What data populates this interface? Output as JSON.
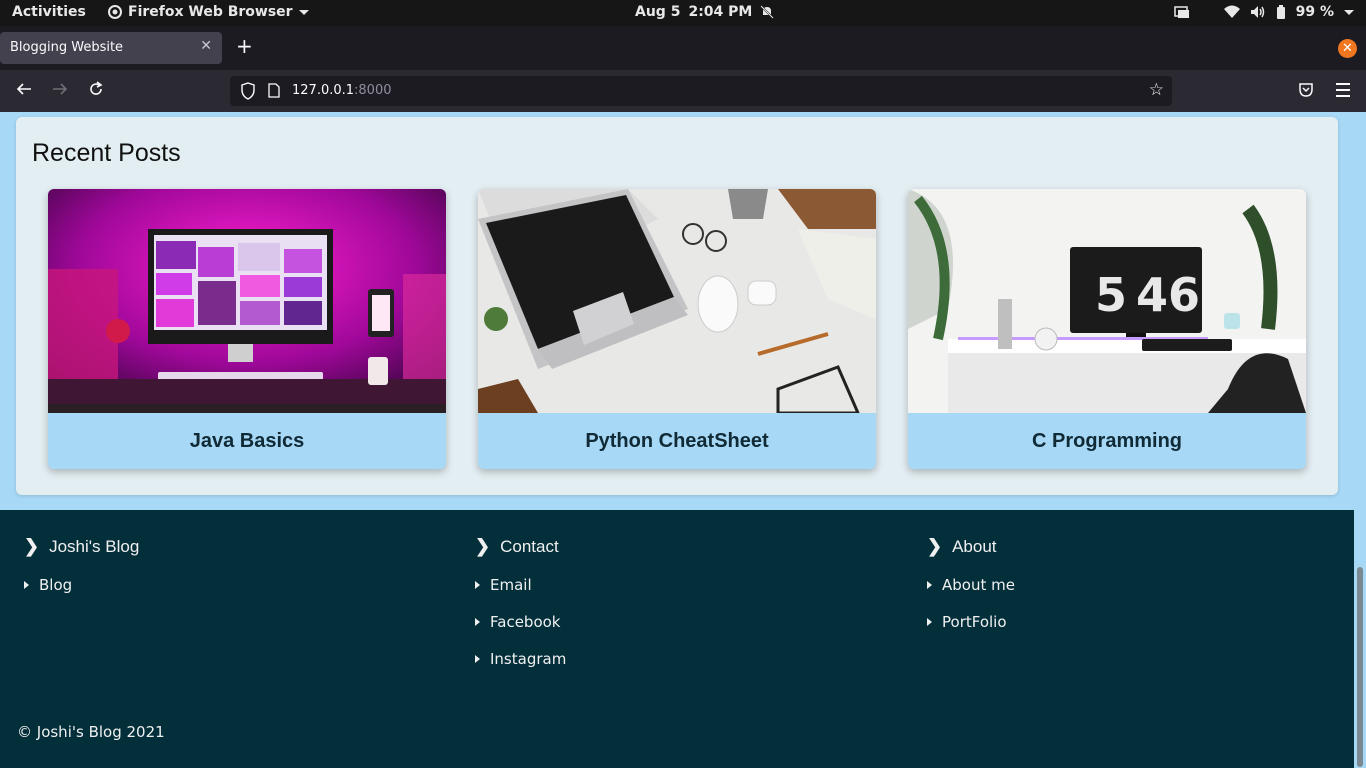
{
  "system_bar": {
    "activities": "Activities",
    "app_name": "Firefox Web Browser",
    "date": "Aug 5",
    "time": "2:04 PM",
    "battery": "99 %"
  },
  "browser": {
    "tab_title": "Blogging Website",
    "url_host": "127.0.0.1",
    "url_port": ":8000"
  },
  "recent_posts": {
    "heading": "Recent Posts",
    "cards": [
      {
        "title": "Java Basics"
      },
      {
        "title": "Python CheatSheet"
      },
      {
        "title": "C Programming"
      }
    ]
  },
  "footer": {
    "columns": [
      {
        "heading": "Joshi's Blog",
        "links": [
          "Blog"
        ]
      },
      {
        "heading": "Contact",
        "links": [
          "Email",
          "Facebook",
          "Instagram"
        ]
      },
      {
        "heading": "About",
        "links": [
          "About me",
          "PortFolio"
        ]
      }
    ],
    "copyright": "© Joshi's Blog 2021"
  },
  "clock_display": {
    "hours": "5",
    "minutes": "46"
  },
  "colors": {
    "page_bg": "#a7d8f5",
    "footer_bg": "#032f3b",
    "card_caption_bg": "#a7d8f5",
    "accent_orange": "#f0761f"
  }
}
